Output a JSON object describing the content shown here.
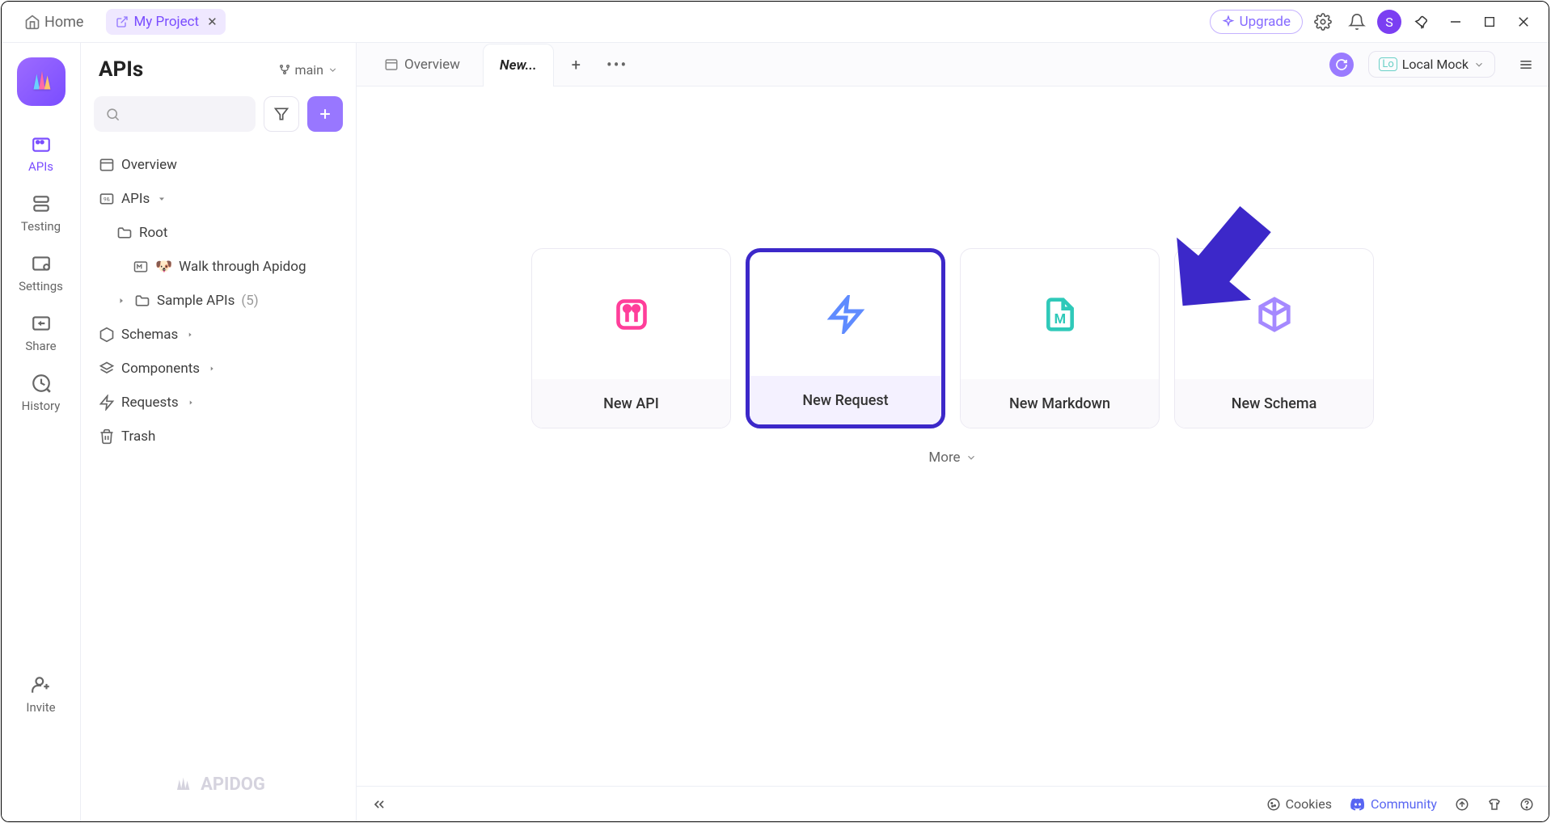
{
  "topbar": {
    "home": "Home",
    "project_tab": "My Project",
    "upgrade": "Upgrade",
    "avatar_letter": "S"
  },
  "rail": {
    "items": [
      {
        "label": "APIs",
        "active": true
      },
      {
        "label": "Testing",
        "active": false
      },
      {
        "label": "Settings",
        "active": false
      },
      {
        "label": "Share",
        "active": false
      },
      {
        "label": "History",
        "active": false
      }
    ],
    "invite": "Invite"
  },
  "sidebar": {
    "title": "APIs",
    "branch": "main",
    "tree": {
      "overview": "Overview",
      "apis": "APIs",
      "root": "Root",
      "walkthrough": "Walk through Apidog",
      "sample_apis": "Sample APIs",
      "sample_count": "(5)",
      "schemas": "Schemas",
      "components": "Components",
      "requests": "Requests",
      "trash": "Trash"
    },
    "footer_brand": "APIDOG"
  },
  "main": {
    "tabs": {
      "overview": "Overview",
      "new": "New..."
    },
    "env": {
      "prefix": "Lo",
      "label": "Local Mock"
    },
    "cards": {
      "new_api": "New API",
      "new_request": "New Request",
      "new_markdown": "New Markdown",
      "new_schema": "New Schema"
    },
    "more": "More"
  },
  "bottombar": {
    "cookies": "Cookies",
    "community": "Community"
  },
  "colors": {
    "accent": "#7a4dff",
    "highlight": "#3c28c9",
    "api_icon": "#ff3e9a",
    "request_icon": "#5f8bff",
    "markdown_icon": "#2fc9b9",
    "schema_icon": "#a589ff"
  }
}
